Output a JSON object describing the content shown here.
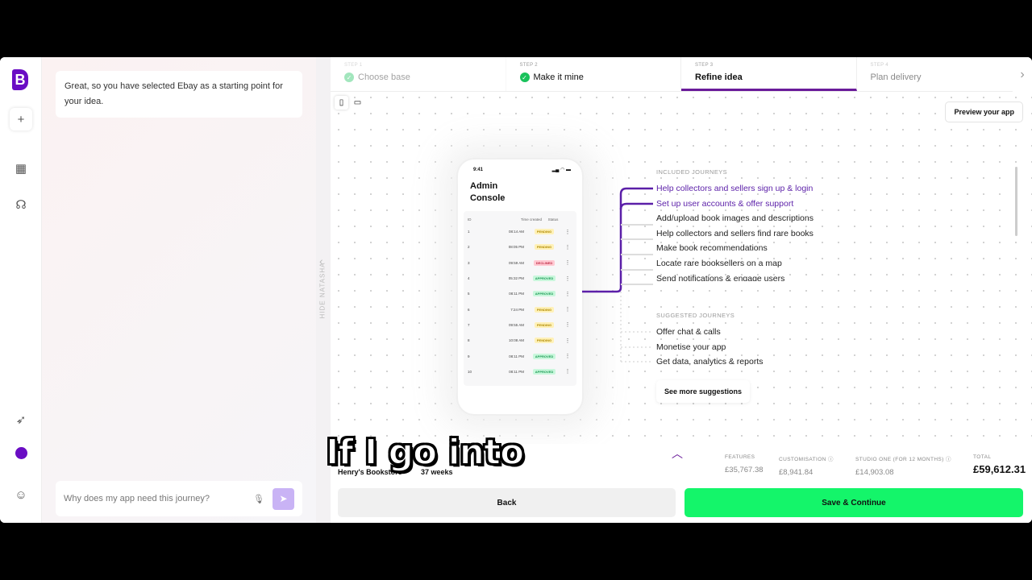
{
  "chat": {
    "message": "Great, so you have selected Ebay as a starting point for your idea.",
    "input_placeholder": "Why does my app need this journey?"
  },
  "hide_label": "HIDE NATASHA",
  "steps": [
    {
      "n": "STEP 1",
      "t": "Choose base"
    },
    {
      "n": "STEP 2",
      "t": "Make it mine"
    },
    {
      "n": "STEP 3",
      "t": "Refine idea"
    },
    {
      "n": "STEP 4",
      "t": "Plan delivery"
    }
  ],
  "preview_label": "Preview your app",
  "phone": {
    "time": "9:41",
    "title": "Admin Console",
    "headers": [
      "ID",
      "Time created",
      "Status"
    ],
    "rows": [
      [
        "1",
        "08:14 AM",
        "PENDING"
      ],
      [
        "2",
        "08:05 PM",
        "PENDING"
      ],
      [
        "3",
        "09:59 AM",
        "DECLINED"
      ],
      [
        "4",
        "05:32 PM",
        "APPROVED"
      ],
      [
        "5",
        "08:11 PM",
        "APPROVED"
      ],
      [
        "6",
        "7:24 PM",
        "PENDING"
      ],
      [
        "7",
        "09:55 AM",
        "PENDING"
      ],
      [
        "8",
        "10:08 AM",
        "PENDING"
      ],
      [
        "9",
        "08:11 PM",
        "APPROVED"
      ],
      [
        "10",
        "08:11 PM",
        "APPROVED"
      ]
    ]
  },
  "journeys": {
    "included_heading": "INCLUDED JOURNEYS",
    "included": [
      "Help collectors and sellers sign up & login",
      "Set up user accounts & offer support",
      "Add/upload book images and descriptions",
      "Help collectors and sellers find rare books",
      "Make book recommendations",
      "Locate rare booksellers on a map",
      "Send notifications & engage users"
    ],
    "suggested_heading": "SUGGESTED JOURNEYS",
    "suggested": [
      "Offer chat & calls",
      "Monetise your app",
      "Get data, analytics & reports"
    ],
    "more_label": "See more suggestions"
  },
  "summary": {
    "project": "Henry's Bookstore",
    "duration": "37 weeks",
    "features_label": "FEATURES",
    "features": "£35,767.38",
    "custom_label": "CUSTOMISATION",
    "custom": "£8,941.84",
    "studio_label": "STUDIO ONE (FOR 12 MONTHS)",
    "studio": "£14,903.08",
    "total_label": "TOTAL",
    "total": "£59,612.31"
  },
  "back_label": "Back",
  "save_label": "Save & Continue",
  "caption": "If I go into",
  "colors": {
    "accent": "#6a1b9a",
    "save": "#14f56a",
    "pending": "#fff1b8",
    "declined": "#ffc9d2",
    "approved": "#c9f7dc"
  }
}
